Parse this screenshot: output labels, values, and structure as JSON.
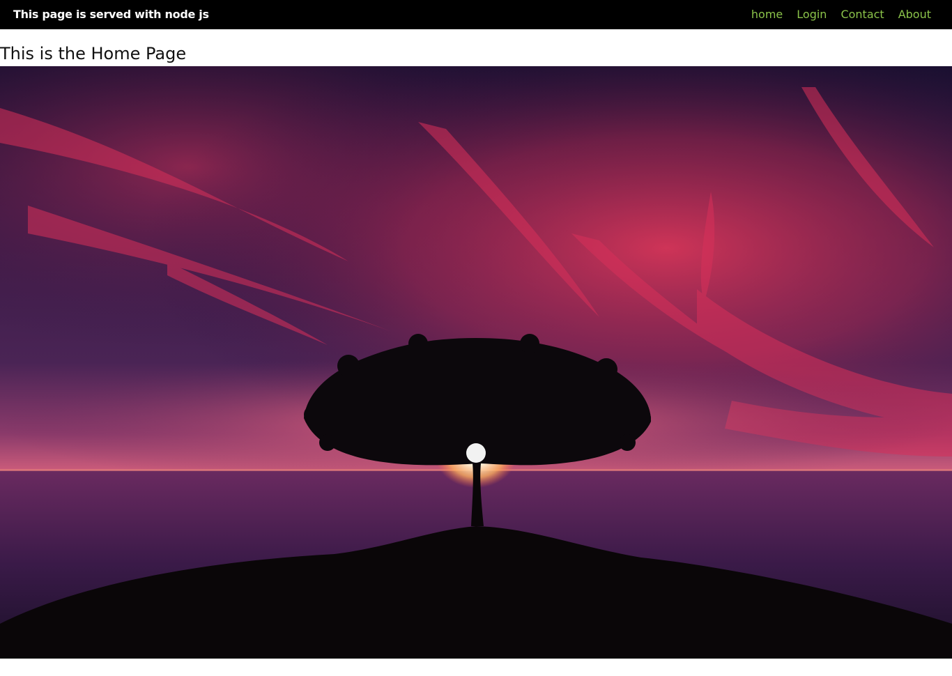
{
  "header": {
    "brand": "This page is served with node js",
    "nav": [
      "home",
      "Login",
      "Contact",
      "About"
    ],
    "link_color": "#8bc34a",
    "background": "#000000"
  },
  "main": {
    "title": "This is the Home Page"
  },
  "hero_image": {
    "icon": "sunset-tree-landscape-image"
  }
}
